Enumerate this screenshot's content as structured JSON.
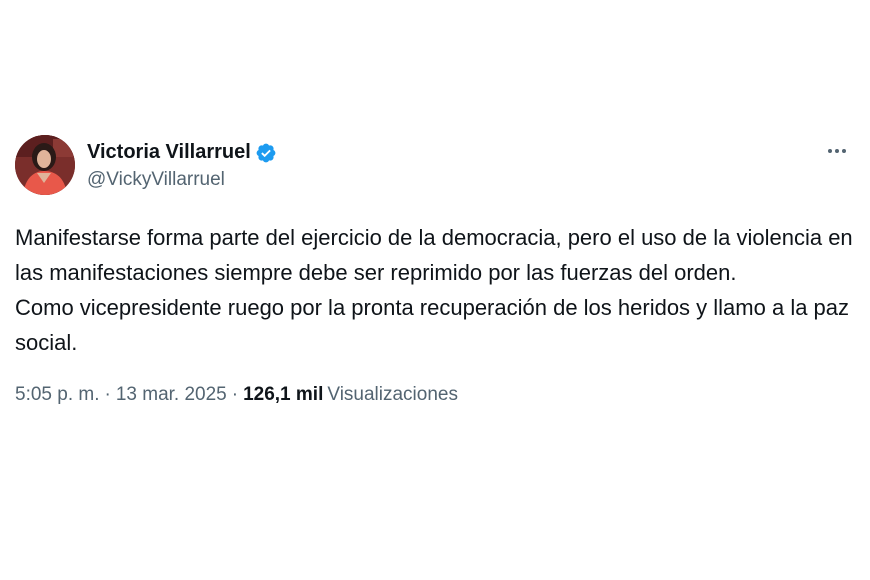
{
  "author": {
    "display_name": "Victoria Villarruel",
    "handle": "@VickyVillarruel",
    "verified": true
  },
  "tweet": {
    "paragraphs": [
      "Manifestarse forma parte del ejercicio de la democracia, pero el uso de la violencia en las manifestaciones siempre debe ser reprimido por las fuerzas del orden.",
      "Como vicepresidente ruego por la pronta recuperación de los heridos y llamo a la paz social."
    ],
    "time": "5:05 p. m.",
    "separator": "·",
    "date": "13 mar. 2025",
    "views_count": "126,1 mil",
    "views_label": "Visualizaciones"
  },
  "icons": {
    "verified": "verified-badge-icon",
    "more": "more-options-icon"
  },
  "colors": {
    "verified_blue": "#1d9bf0",
    "text_primary": "#0f1419",
    "text_secondary": "#536471"
  }
}
